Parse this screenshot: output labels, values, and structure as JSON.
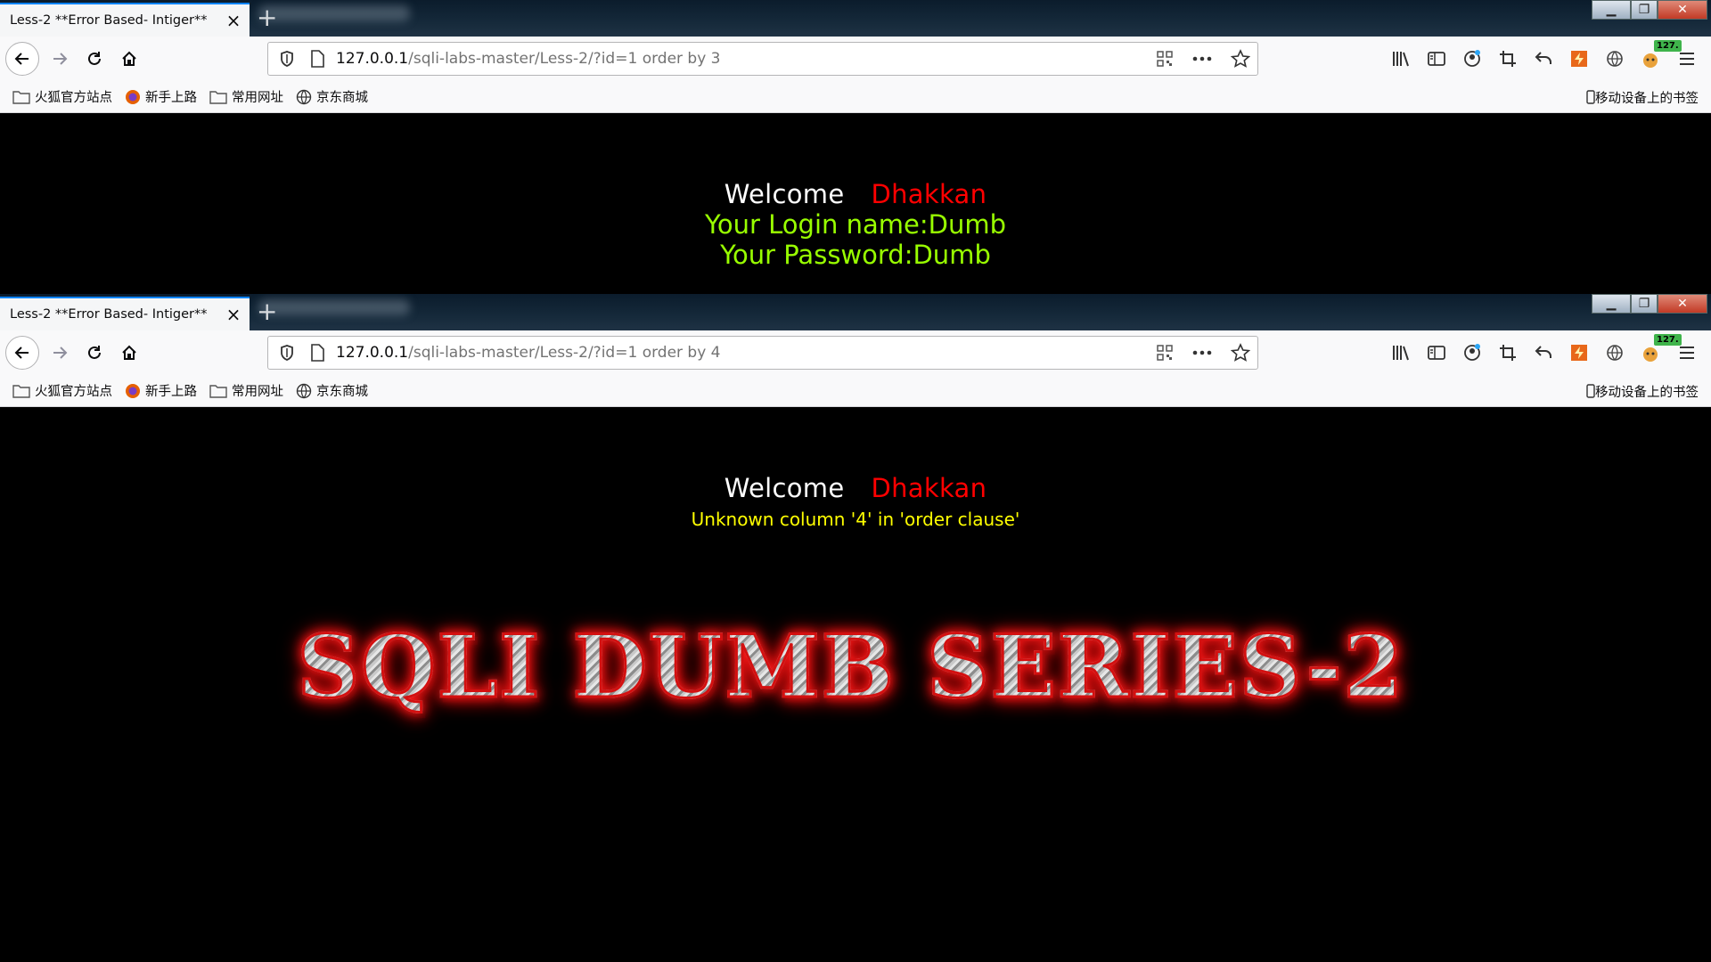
{
  "shot_a": {
    "tab_title": "Less-2 **Error Based- Intiger**",
    "url_host": "127.0.0.1",
    "url_path": "/sqli-labs-master/Less-2/?id=1 order by 3",
    "badge": "127.",
    "page": {
      "welcome": "Welcome",
      "name": "Dhakkan",
      "login_line": "Your Login name:Dumb",
      "password_line": "Your Password:Dumb"
    }
  },
  "shot_b": {
    "tab_title": "Less-2 **Error Based- Intiger**",
    "url_host": "127.0.0.1",
    "url_path": "/sqli-labs-master/Less-2/?id=1 order by 4",
    "badge": "127.",
    "page": {
      "welcome": "Welcome",
      "name": "Dhakkan",
      "error": "Unknown column '4' in 'order clause'",
      "banner_text": "SQLI DUMB SERIES-2"
    }
  },
  "bookmarks": [
    "火狐官方站点",
    "新手上路",
    "常用网址",
    "京东商城"
  ],
  "mobile_bookmarks": "移动设备上的书签",
  "icons": {
    "back": "back-arrow-icon",
    "forward": "forward-arrow-icon",
    "reload": "reload-icon",
    "home": "home-icon",
    "shield": "tracking-shield-icon",
    "page": "page-icon",
    "qr": "qr-code-icon",
    "more": "more-actions-icon",
    "star": "bookmark-star-icon",
    "library": "library-icon",
    "sidebar": "sidebar-icon",
    "account": "account-icon",
    "crop": "screenshot-crop-icon",
    "undo": "undo-icon",
    "menu": "hamburger-menu-icon"
  },
  "colors": {
    "accent": "#0a84ff",
    "welcome_name": "#ff0000",
    "login_text": "#99ff00",
    "error_text": "#ffff00"
  }
}
